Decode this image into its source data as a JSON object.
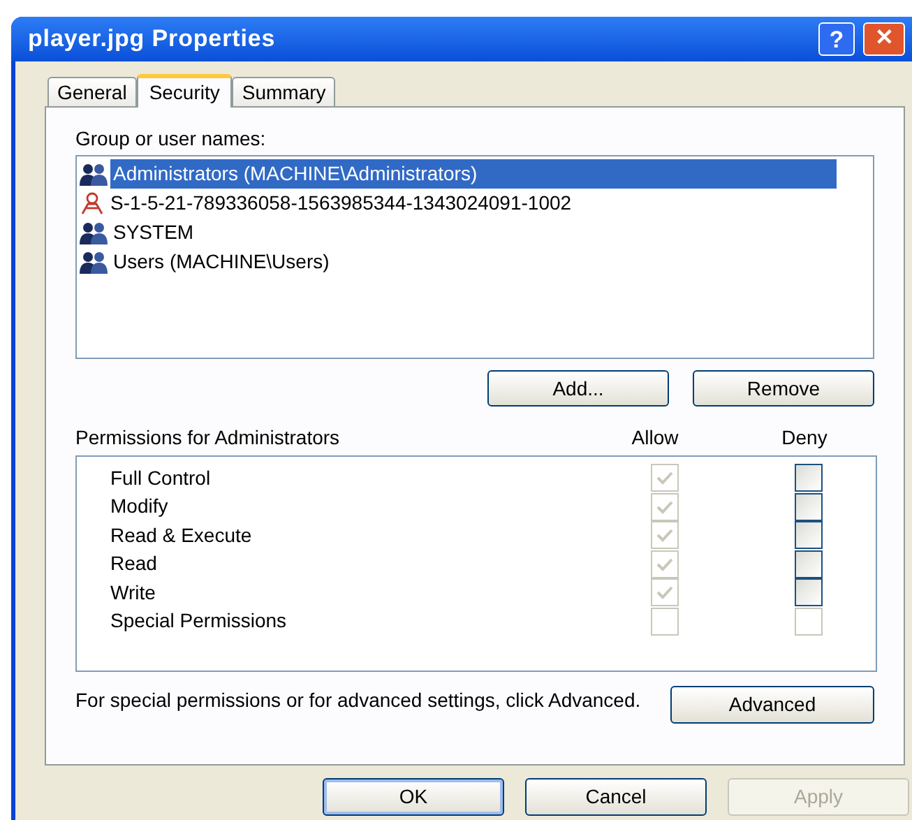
{
  "window": {
    "title": "player.jpg Properties",
    "help_button": "?",
    "close_button": "✕"
  },
  "tabs": [
    {
      "label": "General",
      "selected": false
    },
    {
      "label": "Security",
      "selected": true
    },
    {
      "label": "Summary",
      "selected": false
    }
  ],
  "group_list": {
    "label": "Group or user names:",
    "items": [
      {
        "kind": "group",
        "name": "Administrators (MACHINE\\Administrators)",
        "selected": true
      },
      {
        "kind": "unknown",
        "name": "S-1-5-21-789336058-1563985344-1343024091-1002",
        "selected": false
      },
      {
        "kind": "group",
        "name": "SYSTEM",
        "selected": false
      },
      {
        "kind": "group",
        "name": "Users (MACHINE\\Users)",
        "selected": false
      }
    ]
  },
  "group_buttons": [
    "Add...",
    "Remove"
  ],
  "permissions": {
    "label": "Permissions for Administrators",
    "allow_heading": "Allow",
    "deny_heading": "Deny",
    "rows": [
      {
        "name": "Full Control",
        "allow": {
          "checked": true,
          "disabled": true
        },
        "deny": {
          "checked": false,
          "disabled": false
        }
      },
      {
        "name": "Modify",
        "allow": {
          "checked": true,
          "disabled": true
        },
        "deny": {
          "checked": false,
          "disabled": false
        }
      },
      {
        "name": "Read & Execute",
        "allow": {
          "checked": true,
          "disabled": true
        },
        "deny": {
          "checked": false,
          "disabled": false
        }
      },
      {
        "name": "Read",
        "allow": {
          "checked": true,
          "disabled": true
        },
        "deny": {
          "checked": false,
          "disabled": false
        }
      },
      {
        "name": "Write",
        "allow": {
          "checked": true,
          "disabled": true
        },
        "deny": {
          "checked": false,
          "disabled": false
        }
      },
      {
        "name": "Special Permissions",
        "allow": {
          "checked": false,
          "disabled": true
        },
        "deny": {
          "checked": false,
          "disabled": true
        }
      }
    ]
  },
  "advanced": {
    "text": "For special permissions or for advanced settings, click Advanced.",
    "button": "Advanced"
  },
  "dialog_buttons": [
    {
      "label": "OK",
      "disabled": false
    },
    {
      "label": "Cancel",
      "disabled": false
    },
    {
      "label": "Apply",
      "disabled": true
    }
  ]
}
